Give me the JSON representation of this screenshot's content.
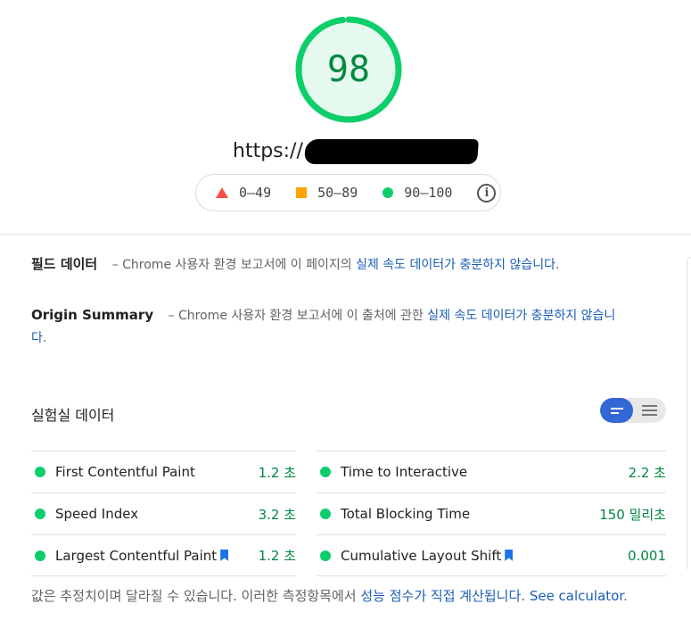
{
  "score": {
    "value": "98",
    "fraction": 0.98,
    "color": "#0cce6b"
  },
  "url": {
    "text": "https://"
  },
  "legend": {
    "fail": "0–49",
    "average": "50–89",
    "pass": "90–100"
  },
  "field_data": {
    "title": "필드 데이터",
    "dash": "–",
    "brand": "Chrome",
    "text": " 사용자 환경 보고서에 이 페이지의 ",
    "link": "실제 속도 데이터가 충분하지 않습니다",
    "end": "."
  },
  "origin_summary": {
    "title": "Origin Summary",
    "dash": "–",
    "brand": "Chrome",
    "text": " 사용자 환경 보고서에 이 출처에 관한 ",
    "link": "실제 속도 데이터가 충분하지 않습니다",
    "end": "."
  },
  "lab_data": {
    "title": "실험실 데이터"
  },
  "metrics_left": [
    {
      "name": "First Contentful Paint",
      "value": "1.2 초"
    },
    {
      "name": "Speed Index",
      "value": "3.2 초"
    },
    {
      "name": "Largest Contentful Paint",
      "value": "1.2 초"
    }
  ],
  "metrics_right": [
    {
      "name": "Time to Interactive",
      "value": "2.2 초"
    },
    {
      "name": "Total Blocking Time",
      "value": "150 밀리초"
    },
    {
      "name": "Cumulative Layout Shift",
      "value": "0.001"
    }
  ],
  "footnote": {
    "text": "값은 추정치이며 달라질 수 있습니다. 이러한 측정항목에서 ",
    "link1": "성능 점수가 직접 계산됩니다",
    "mid": ". ",
    "link2": "See calculator",
    "end": "."
  },
  "colors": {
    "pass": "#0cce6b",
    "average": "#ffa400",
    "fail": "#ff4e42",
    "link": "#1a5fb4",
    "toggle_on": "#3367d6"
  }
}
